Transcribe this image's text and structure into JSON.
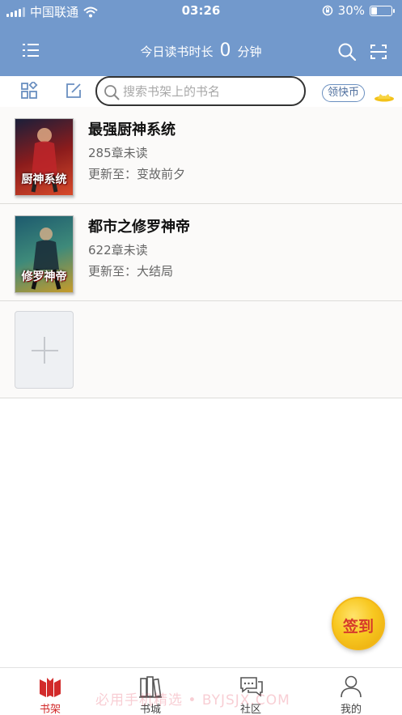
{
  "status_bar": {
    "carrier": "中国联通",
    "time": "03:26",
    "battery_text": "30%",
    "battery_level": 0.3
  },
  "header": {
    "reading_label": "今日读书时长",
    "reading_value": "0",
    "reading_unit": "分钟",
    "icons": [
      "menu-icon",
      "search-icon",
      "scan-icon"
    ]
  },
  "toolbar": {
    "search_placeholder": "搜索书架上的书名",
    "coin_button": "领快币",
    "icons": [
      "grid-view-icon",
      "edit-icon",
      "coin-decoration-icon"
    ]
  },
  "books": [
    {
      "title": "最强厨神系统",
      "unread": "285章未读",
      "update_label": "更新至：",
      "update_chapter": "变故前夕",
      "cover_text": "厨神系统",
      "cover_colors": [
        "#1a1f3a",
        "#8c1c1c",
        "#d84a2a"
      ]
    },
    {
      "title": "都市之修罗神帝",
      "unread": "622章未读",
      "update_label": "更新至：",
      "update_chapter": "大结局",
      "cover_text": "修罗神帝",
      "cover_colors": [
        "#1d5a6e",
        "#3e8a7a",
        "#c89b2a"
      ]
    }
  ],
  "add_button": "add-book-icon",
  "signin_button": "签到",
  "tabs": [
    {
      "label": "书架",
      "icon": "bookshelf-icon",
      "active": true
    },
    {
      "label": "书城",
      "icon": "bookstore-icon",
      "active": false
    },
    {
      "label": "社区",
      "icon": "community-icon",
      "active": false
    },
    {
      "label": "我的",
      "icon": "profile-icon",
      "active": false
    }
  ],
  "watermark": "必用手机精选 • BYJSJX.COM",
  "colors": {
    "header_blue": "#7299cc",
    "accent_red": "#d22b2b",
    "signin_gold": "#f8c821"
  }
}
